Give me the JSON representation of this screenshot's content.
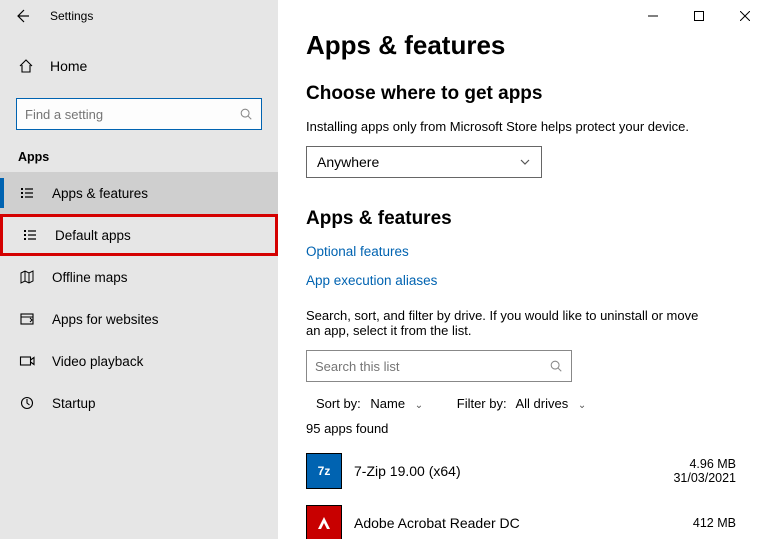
{
  "window": {
    "title": "Settings"
  },
  "sidebar": {
    "home": "Home",
    "search_placeholder": "Find a setting",
    "section_label": "Apps",
    "items": [
      {
        "label": "Apps & features"
      },
      {
        "label": "Default apps"
      },
      {
        "label": "Offline maps"
      },
      {
        "label": "Apps for websites"
      },
      {
        "label": "Video playback"
      },
      {
        "label": "Startup"
      }
    ]
  },
  "main": {
    "title": "Apps & features",
    "choose_heading": "Choose where to get apps",
    "choose_sub": "Installing apps only from Microsoft Store helps protect your device.",
    "dropdown_value": "Anywhere",
    "section2_heading": "Apps & features",
    "link_optional": "Optional features",
    "link_aliases": "App execution aliases",
    "filter_help": "Search, sort, and filter by drive. If you would like to uninstall or move an app, select it from the list.",
    "filter_placeholder": "Search this list",
    "sort_label": "Sort by:",
    "sort_value": "Name",
    "filter_label": "Filter by:",
    "filter_value": "All drives",
    "count_text": "95 apps found",
    "apps": [
      {
        "name": "7-Zip 19.00 (x64)",
        "size": "4.96 MB",
        "date": "31/03/2021",
        "icon": "7z"
      },
      {
        "name": "Adobe Acrobat Reader DC",
        "size": "412 MB",
        "date": "",
        "icon": "adobe"
      }
    ]
  }
}
